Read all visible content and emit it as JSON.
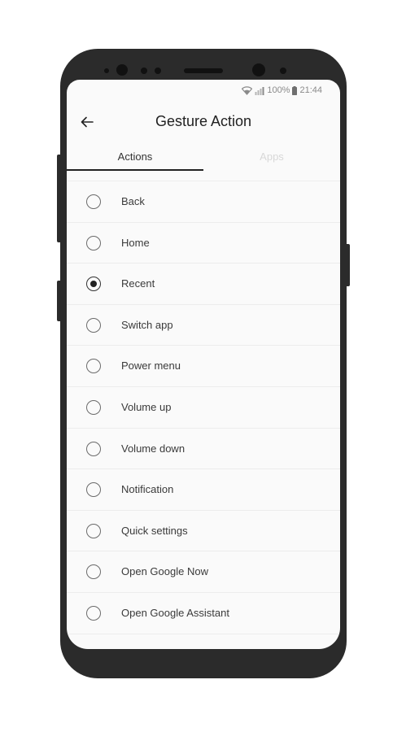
{
  "status_bar": {
    "battery": "100%",
    "time": "21:44",
    "wifi_icon": "wifi-icon",
    "signal_icon": "signal-icon",
    "battery_icon": "battery-icon"
  },
  "header": {
    "title": "Gesture Action",
    "back_icon": "arrow-left-icon"
  },
  "tabs": [
    {
      "label": "Actions",
      "selected": true
    },
    {
      "label": "Apps",
      "selected": false
    }
  ],
  "actions": [
    {
      "label": "Back",
      "selected": false
    },
    {
      "label": "Home",
      "selected": false
    },
    {
      "label": "Recent",
      "selected": true
    },
    {
      "label": "Switch app",
      "selected": false
    },
    {
      "label": "Power menu",
      "selected": false
    },
    {
      "label": "Volume up",
      "selected": false
    },
    {
      "label": "Volume down",
      "selected": false
    },
    {
      "label": "Notification",
      "selected": false
    },
    {
      "label": "Quick settings",
      "selected": false
    },
    {
      "label": "Open Google Now",
      "selected": false
    },
    {
      "label": "Open Google Assistant",
      "selected": false
    }
  ],
  "colors": {
    "text_primary": "#212121",
    "tab_inactive": "#d8d8d8",
    "indicator": "#222222",
    "frame": "#2b2b2b"
  }
}
